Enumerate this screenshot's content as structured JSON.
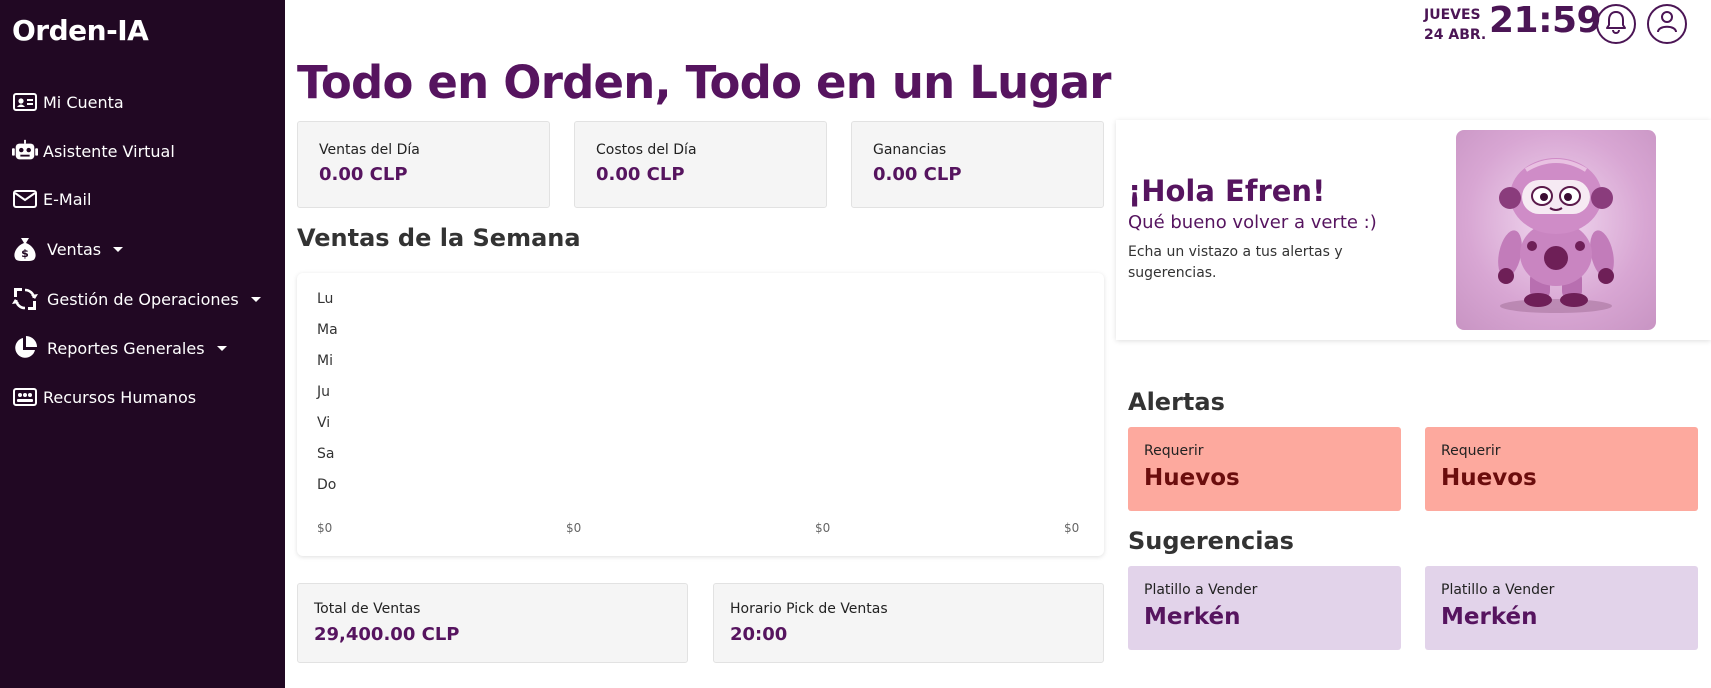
{
  "sidebar": {
    "brand": "Orden-IA",
    "items": [
      {
        "label": "Mi Cuenta",
        "icon": "id-card-icon",
        "dropdown": false
      },
      {
        "label": "Asistente Virtual",
        "icon": "robot-icon",
        "dropdown": false
      },
      {
        "label": "E-Mail",
        "icon": "envelope-icon",
        "dropdown": false
      },
      {
        "label": "Ventas",
        "icon": "money-bag-icon",
        "dropdown": true
      },
      {
        "label": "Gestión de Operaciones",
        "icon": "sync-icon",
        "dropdown": true
      },
      {
        "label": "Reportes Generales",
        "icon": "pie-chart-icon",
        "dropdown": true
      },
      {
        "label": "Recursos Humanos",
        "icon": "people-card-icon",
        "dropdown": false
      }
    ]
  },
  "topbar": {
    "weekday": "JUEVES",
    "date": "24 ABR.",
    "time": "21:59",
    "icons": [
      "bell-icon",
      "user-icon"
    ]
  },
  "page": {
    "title": "Todo en Orden, Todo en un Lugar"
  },
  "stats": [
    {
      "label": "Ventas del Día",
      "value": "0.00 CLP"
    },
    {
      "label": "Costos del Día",
      "value": "0.00 CLP"
    },
    {
      "label": "Ganancias",
      "value": "0.00 CLP"
    }
  ],
  "week": {
    "title": "Ventas de la Semana"
  },
  "chart_data": {
    "type": "bar",
    "orientation": "horizontal",
    "categories": [
      "Lu",
      "Ma",
      "Mi",
      "Ju",
      "Vi",
      "Sa",
      "Do"
    ],
    "values": [
      0,
      0,
      0,
      0,
      0,
      0,
      0
    ],
    "x_tick_labels": [
      "$0",
      "$0",
      "$0",
      "$0"
    ],
    "grid": false
  },
  "greeting": {
    "title": "¡Hola Efren!",
    "subtitle": "Qué bueno volver a verte :)",
    "text": "Echa un vistazo a tus alertas y sugerencias."
  },
  "alerts": {
    "title": "Alertas",
    "items": [
      {
        "label": "Requerir",
        "value": "Huevos"
      },
      {
        "label": "Requerir",
        "value": "Huevos"
      }
    ]
  },
  "suggestions": {
    "title": "Sugerencias",
    "items": [
      {
        "label": "Platillo a Vender",
        "value": "Merkén"
      },
      {
        "label": "Platillo a Vender",
        "value": "Merkén"
      }
    ]
  },
  "bottom": [
    {
      "label": "Total de Ventas",
      "value": "29,400.00 CLP"
    },
    {
      "label": "Horario Pick de Ventas",
      "value": "20:00"
    }
  ],
  "colors": {
    "sidebar": "#210823",
    "accent": "#56145f",
    "alert": "#fda99e",
    "suggestion": "#e2d3ea"
  }
}
